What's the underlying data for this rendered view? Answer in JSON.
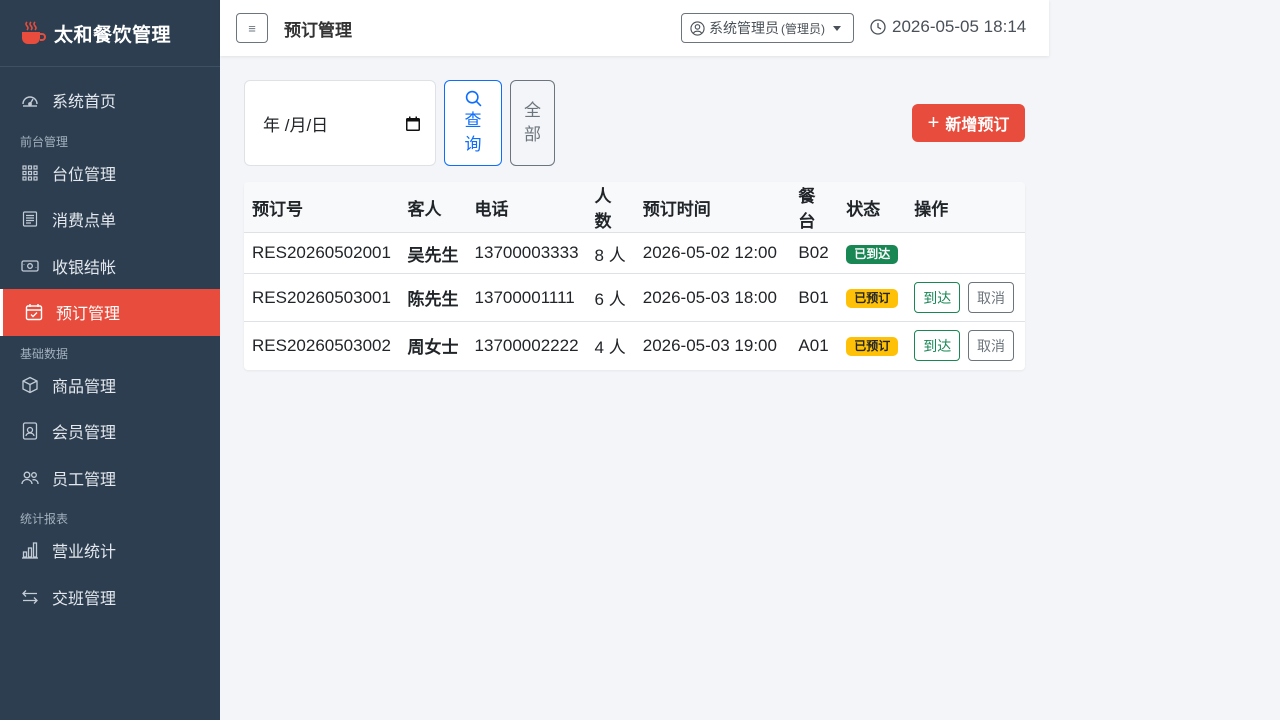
{
  "app": {
    "name": "太和餐饮管理"
  },
  "sidebar": {
    "home": {
      "label": "系统首页",
      "icon": "dashboard-icon"
    },
    "sections": [
      {
        "title": "前台管理",
        "items": [
          {
            "label": "台位管理",
            "icon": "grid-icon"
          },
          {
            "label": "消费点单",
            "icon": "receipt-icon"
          },
          {
            "label": "收银结帐",
            "icon": "cash-icon"
          },
          {
            "label": "预订管理",
            "icon": "calendar-check-icon",
            "active": true
          }
        ]
      },
      {
        "title": "基础数据",
        "items": [
          {
            "label": "商品管理",
            "icon": "box-icon"
          },
          {
            "label": "会员管理",
            "icon": "member-card-icon"
          },
          {
            "label": "员工管理",
            "icon": "people-icon"
          }
        ]
      },
      {
        "title": "统计报表",
        "items": [
          {
            "label": "营业统计",
            "icon": "bar-chart-icon"
          },
          {
            "label": "交班管理",
            "icon": "swap-icon"
          }
        ]
      }
    ]
  },
  "header": {
    "title": "预订管理",
    "user": "系统管理员",
    "role": "(管理员)",
    "datetime": "2026-05-05 18:14"
  },
  "filters": {
    "date_placeholder": "年 /月/日",
    "query_label": [
      "查",
      "询"
    ],
    "all_label": [
      "全",
      "部"
    ],
    "add_label": "新增预订"
  },
  "table": {
    "columns": [
      "预订号",
      "客人",
      "电话",
      "人数",
      "预订时间",
      "餐台",
      "状态",
      "操作"
    ],
    "rows": [
      {
        "id": "RES20260502001",
        "guest": "吴先生",
        "phone": "13700003333",
        "people": "8 人",
        "time": "2026-05-02 12:00",
        "table": "B02",
        "status": "已到达",
        "status_type": "arrived",
        "actions": []
      },
      {
        "id": "RES20260503001",
        "guest": "陈先生",
        "phone": "13700001111",
        "people": "6 人",
        "time": "2026-05-03 18:00",
        "table": "B01",
        "status": "已预订",
        "status_type": "booked",
        "actions": [
          "到达",
          "取消"
        ]
      },
      {
        "id": "RES20260503002",
        "guest": "周女士",
        "phone": "13700002222",
        "people": "4 人",
        "time": "2026-05-03 19:00",
        "table": "A01",
        "status": "已预订",
        "status_type": "booked",
        "actions": [
          "到达",
          "取消"
        ]
      }
    ]
  },
  "colors": {
    "sidebar_bg": "#2c3e50",
    "accent": "#e74c3c",
    "primary": "#0d6efd",
    "success": "#198754",
    "warning": "#ffc107"
  }
}
